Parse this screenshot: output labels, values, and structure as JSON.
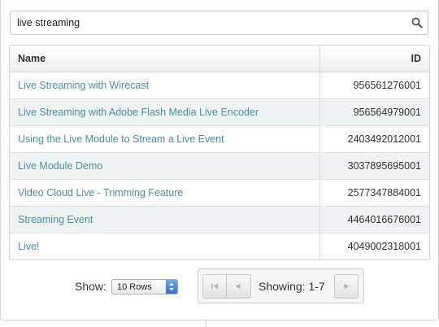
{
  "search": {
    "value": "live streaming",
    "placeholder": ""
  },
  "table": {
    "columns": {
      "name": "Name",
      "id": "ID"
    },
    "rows": [
      {
        "name": "Live Streaming with Wirecast",
        "id": "956561276001"
      },
      {
        "name": "Live Streaming with Adobe Flash Media Live Encoder",
        "id": "956564979001"
      },
      {
        "name": "Using the Live Module to Stream a Live Event",
        "id": "2403492012001"
      },
      {
        "name": "Live Module Demo",
        "id": "3037895695001"
      },
      {
        "name": "Video Cloud Live - Trimming Feature",
        "id": "2577347884001"
      },
      {
        "name": "Streaming Event",
        "id": "4464016676001"
      },
      {
        "name": "Live!",
        "id": "4049002318001"
      }
    ]
  },
  "footer": {
    "show_label": "Show:",
    "rows_per_page": "10 Rows",
    "showing": "Showing: 1-7"
  },
  "icons": {
    "search": "search-icon",
    "first": "first-page-icon",
    "prev": "prev-page-icon",
    "next": "next-page-icon",
    "select": "select-arrows-icon"
  },
  "colors": {
    "link": "#4a8ea8",
    "row_alt": "#f0f3f3",
    "select_accent": "#2f6fd8"
  }
}
